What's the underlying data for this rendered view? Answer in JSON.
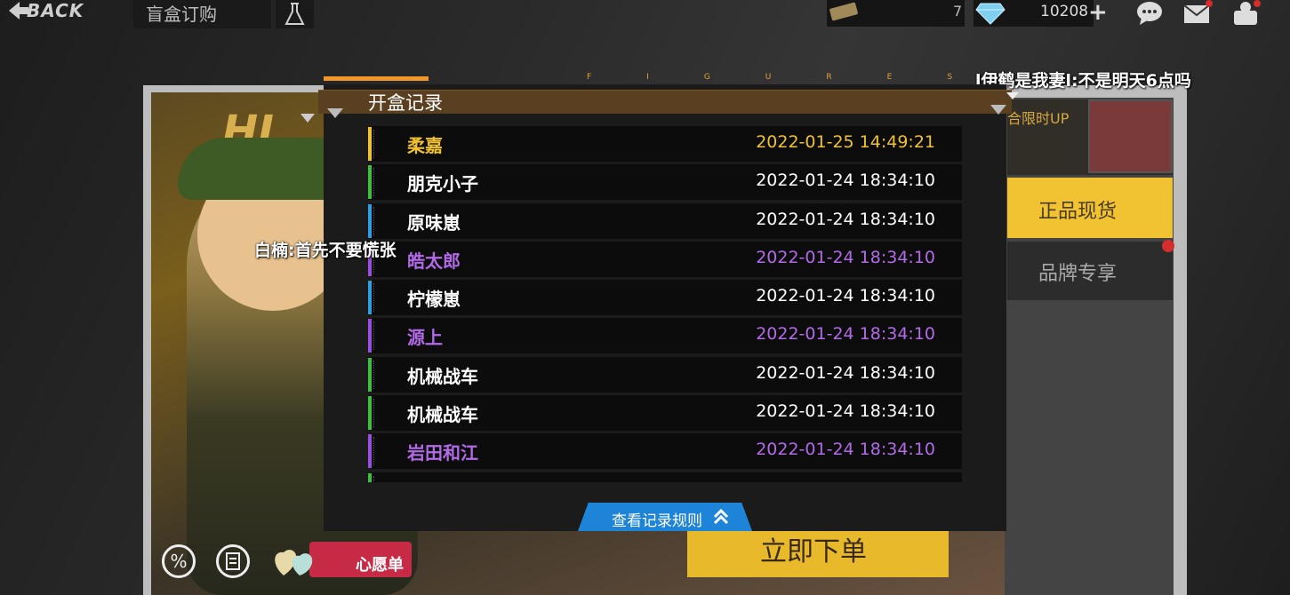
{
  "topbar": {
    "back_label": "BACK",
    "title": "盲盒订购",
    "resource1_count": "7",
    "resource2_count": "10208"
  },
  "banner": {
    "wish_label": "心愿单",
    "order_label": "立即下单",
    "deco_text": "HI"
  },
  "side_menu": {
    "up_label": "合限时UP",
    "genuine_label": "正品现货",
    "brand_label": "品牌专享"
  },
  "chat": {
    "msg1": "l伊鹤是我妻l:不是明天6点吗",
    "msg2": "白楠:首先不要慌张"
  },
  "modal": {
    "deco": "FIGURES",
    "title": "开盒记录",
    "rules_label": "查看记录规则",
    "records": [
      {
        "name": "柔嘉",
        "time": "2022-01-25 14:49:21",
        "rarity_color": "#f0c230",
        "bar_color": "#f0c230"
      },
      {
        "name": "朋克小子",
        "time": "2022-01-24 18:34:10",
        "rarity_color": "#ffffff",
        "bar_color": "#3fbf3f"
      },
      {
        "name": "原味崽",
        "time": "2022-01-24 18:34:10",
        "rarity_color": "#ffffff",
        "bar_color": "#2f9de0"
      },
      {
        "name": "皓太郎",
        "time": "2022-01-24 18:34:10",
        "rarity_color": "#b36ae8",
        "bar_color": "#9a4ee0"
      },
      {
        "name": "柠檬崽",
        "time": "2022-01-24 18:34:10",
        "rarity_color": "#ffffff",
        "bar_color": "#2f9de0"
      },
      {
        "name": "源上",
        "time": "2022-01-24 18:34:10",
        "rarity_color": "#b36ae8",
        "bar_color": "#9a4ee0"
      },
      {
        "name": "机械战车",
        "time": "2022-01-24 18:34:10",
        "rarity_color": "#ffffff",
        "bar_color": "#3fbf3f"
      },
      {
        "name": "机械战车",
        "time": "2022-01-24 18:34:10",
        "rarity_color": "#ffffff",
        "bar_color": "#3fbf3f"
      },
      {
        "name": "岩田和江",
        "time": "2022-01-24 18:34:10",
        "rarity_color": "#b36ae8",
        "bar_color": "#9a4ee0"
      },
      {
        "name": "",
        "time": "",
        "rarity_color": "#ffffff",
        "bar_color": "#3fbf3f"
      }
    ]
  }
}
